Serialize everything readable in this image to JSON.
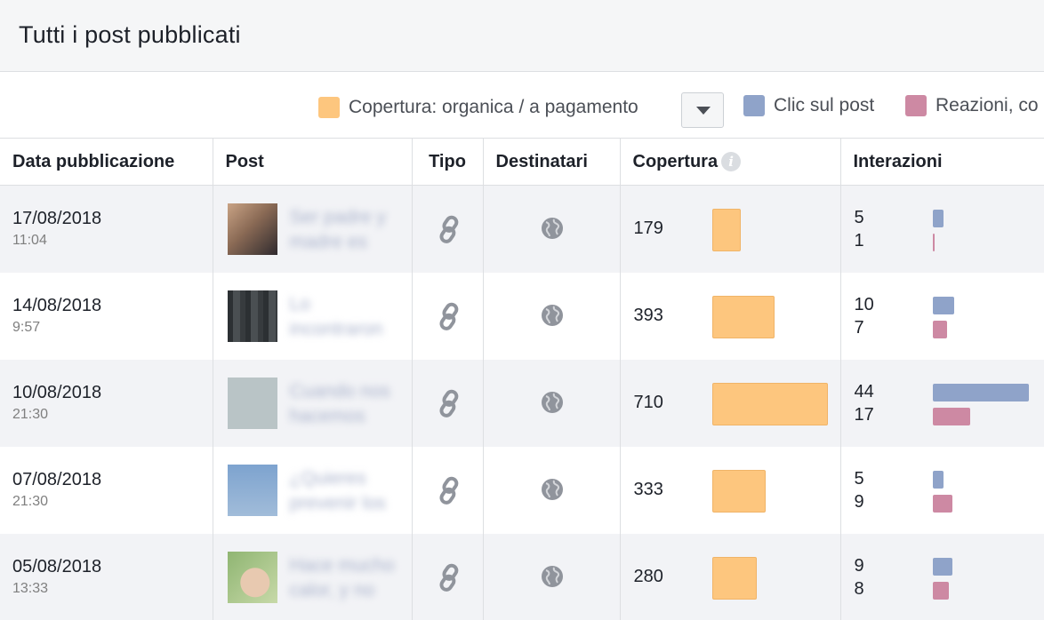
{
  "page_title": "Tutti i post pubblicati",
  "legend": {
    "reach": {
      "label": "Copertura: organica / a pagamento",
      "color": "#fdc67e"
    },
    "clicks": {
      "label": "Clic sul post",
      "color": "#8fa3c9"
    },
    "reactions": {
      "label": "Reazioni, co",
      "color": "#cd89a3"
    }
  },
  "columns": {
    "date": "Data pubblicazione",
    "post": "Post",
    "type": "Tipo",
    "audience": "Destinatari",
    "reach": "Copertura",
    "interactions": "Interazioni"
  },
  "rows": [
    {
      "date": "17/08/2018",
      "time": "11:04",
      "post_line1": "Ser padre y",
      "post_line2": "madre es",
      "thumb_color": "#8a6a55",
      "reach": "179",
      "clicks": "5",
      "reactions": "1"
    },
    {
      "date": "14/08/2018",
      "time": "9:57",
      "post_line1": "Lo",
      "post_line2": "incontraron",
      "thumb_color": "#3e4346",
      "reach": "393",
      "clicks": "10",
      "reactions": "7"
    },
    {
      "date": "10/08/2018",
      "time": "21:30",
      "post_line1": "Cuando nos",
      "post_line2": "hacemos",
      "thumb_color": "#b9c4c6",
      "reach": "710",
      "clicks": "44",
      "reactions": "17"
    },
    {
      "date": "07/08/2018",
      "time": "21:30",
      "post_line1": "¿Quieres",
      "post_line2": "prevenir los",
      "thumb_color": "#89acd3",
      "reach": "333",
      "clicks": "5",
      "reactions": "9"
    },
    {
      "date": "05/08/2018",
      "time": "13:33",
      "post_line1": "Hace mucho",
      "post_line2": "calor, y no",
      "thumb_color": "#9fb98a",
      "reach": "280",
      "clicks": "9",
      "reactions": "8"
    }
  ],
  "icons": {
    "type": "link-icon",
    "audience": "globe-icon",
    "info": "info-icon"
  }
}
